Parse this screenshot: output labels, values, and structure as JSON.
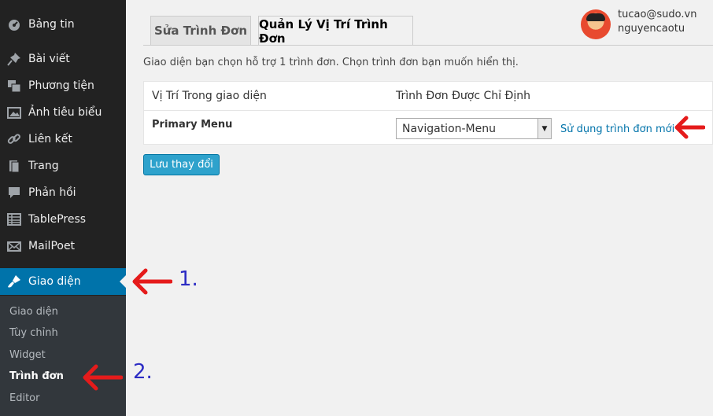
{
  "sidebar": {
    "items": [
      {
        "label": "Bảng tin",
        "icon": "dashboard-icon"
      },
      {
        "label": "Bài viết",
        "icon": "pin-icon"
      },
      {
        "label": "Phương tiện",
        "icon": "media-icon"
      },
      {
        "label": "Ảnh tiêu biểu",
        "icon": "images-icon"
      },
      {
        "label": "Liên kết",
        "icon": "link-icon"
      },
      {
        "label": "Trang",
        "icon": "page-icon"
      },
      {
        "label": "Phản hồi",
        "icon": "comment-icon"
      },
      {
        "label": "TablePress",
        "icon": "table-icon"
      },
      {
        "label": "MailPoet",
        "icon": "mail-icon"
      },
      {
        "label": "Giao diện",
        "icon": "brush-icon",
        "active": true
      }
    ],
    "submenu": [
      "Giao diện",
      "Tùy chỉnh",
      "Widget",
      "Trình đơn",
      "Editor"
    ],
    "current_submenu": "Trình đơn",
    "active_color": "#0073aa"
  },
  "tabs": [
    {
      "label": "Sửa Trình Đơn",
      "active": false
    },
    {
      "label": "Quản Lý Vị Trí Trình Đơn",
      "active": true
    }
  ],
  "user": {
    "email": "tucao@sudo.vn",
    "name": "nguyencaotu"
  },
  "help_text": "Giao diện bạn chọn hỗ trợ 1 trình đơn. Chọn trình đơn bạn muốn hiển thị.",
  "table": {
    "headers": [
      "Vị Trí Trong giao diện",
      "Trình Đơn Được Chỉ Định"
    ],
    "rows": [
      {
        "location": "Primary Menu",
        "selected_menu": "Navigation-Menu",
        "link": "Sử dụng trình đơn mới"
      }
    ]
  },
  "save_label": "Lưu thay đổi",
  "annotations": {
    "step1": "1.",
    "step2": "2.",
    "arrow_color": "#e51b1b"
  }
}
